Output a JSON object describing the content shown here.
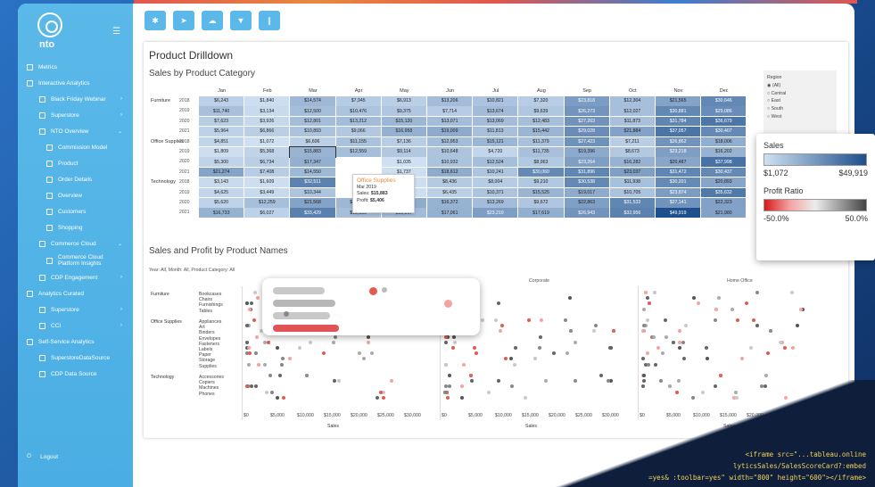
{
  "app": {
    "logo_text": "nto"
  },
  "sidebar": {
    "items": [
      {
        "label": "Metrics",
        "level": 0
      },
      {
        "label": "Interactive Analytics",
        "level": 0
      },
      {
        "label": "Black Friday Webinar",
        "level": 1,
        "arrow": "›"
      },
      {
        "label": "Superstore",
        "level": 1,
        "arrow": "›"
      },
      {
        "label": "NTO Overview",
        "level": 1,
        "arrow": "⌄"
      },
      {
        "label": "Commission Model",
        "level": 2
      },
      {
        "label": "Product",
        "level": 2
      },
      {
        "label": "Order Details",
        "level": 2
      },
      {
        "label": "Overview",
        "level": 2
      },
      {
        "label": "Customers",
        "level": 2
      },
      {
        "label": "Shopping",
        "level": 2
      },
      {
        "label": "Commerce Cloud",
        "level": 1,
        "arrow": "⌄"
      },
      {
        "label": "Commerce Cloud Platform Insights",
        "level": 2
      },
      {
        "label": "CDP Engagement",
        "level": 1,
        "arrow": "›"
      },
      {
        "label": "Analytics Curated",
        "level": 0
      },
      {
        "label": "Superstore",
        "level": 1,
        "arrow": "›"
      },
      {
        "label": "CCI",
        "level": 1,
        "arrow": "›"
      },
      {
        "label": "Self-Service Analytics",
        "level": 0
      },
      {
        "label": "SuperstoreDataSource",
        "level": 1
      },
      {
        "label": "CDP Data Source",
        "level": 1
      }
    ],
    "logout": "Logout"
  },
  "dashboard": {
    "title": "Product Drilldown",
    "section1": "Sales by Product Category",
    "section2": "Sales and Profit by Product Names",
    "filter_text": "Year: All, Month: All, Product Category: All"
  },
  "heatmap": {
    "months": [
      "Jan",
      "Feb",
      "Mar",
      "Apr",
      "May",
      "Jun",
      "Jul",
      "Aug",
      "Sep",
      "Oct",
      "Nov",
      "Dec"
    ],
    "categories": [
      {
        "name": "Furniture",
        "rows": [
          {
            "year": "2018",
            "cells": [
              "$6,243",
              "$1,840",
              "$14,574",
              "$7,945",
              "$6,913",
              "$13,206",
              "$10,821",
              "$7,320",
              "$23,818",
              "$12,304",
              "$21,565",
              "$30,646"
            ]
          },
          {
            "year": "2019",
            "cells": [
              "$11,740",
              "$3,134",
              "$12,500",
              "$10,476",
              "$9,375",
              "$7,714",
              "$13,674",
              "$9,639",
              "$26,273",
              "$12,027",
              "$30,881",
              "$29,086"
            ]
          },
          {
            "year": "2020",
            "cells": [
              "$7,623",
              "$3,926",
              "$12,801",
              "$13,212",
              "$15,120",
              "$13,071",
              "$13,069",
              "$12,483",
              "$27,263",
              "$11,873",
              "$31,784",
              "$36,679"
            ]
          },
          {
            "year": "2021",
            "cells": [
              "$5,964",
              "$6,866",
              "$10,893",
              "$9,066",
              "$16,958",
              "$19,009",
              "$11,813",
              "$15,442",
              "$29,028",
              "$21,884",
              "$37,057",
              "$30,407"
            ]
          }
        ]
      },
      {
        "name": "Office Supplies",
        "rows": [
          {
            "year": "2018",
            "cells": [
              "$4,851",
              "$1,072",
              "$6,606",
              "$11,155",
              "$7,136",
              "$12,953",
              "$15,121",
              "$11,379",
              "$27,423",
              "$7,211",
              "$26,862",
              "$18,006"
            ]
          },
          {
            "year": "2019",
            "cells": [
              "$1,809",
              "$5,368",
              "$15,883",
              "$12,559",
              "$9,114",
              "$10,648",
              "$4,720",
              "$11,735",
              "$19,396",
              "$8,673",
              "$23,218",
              "$16,202"
            ]
          },
          {
            "year": "2020",
            "cells": [
              "$5,300",
              "$6,734",
              "$17,347",
              "",
              "$1,035",
              "$10,932",
              "$12,524",
              "$8,963",
              "$23,264",
              "$16,282",
              "$20,487",
              "$37,998"
            ]
          },
          {
            "year": "2021",
            "cells": [
              "$21,274",
              "$7,408",
              "$14,550",
              "",
              "$1,737",
              "$18,612",
              "$10,241",
              "$30,060",
              "$31,896",
              "$23,037",
              "$31,472",
              "$30,437"
            ]
          }
        ]
      },
      {
        "name": "Technology",
        "rows": [
          {
            "year": "2018",
            "cells": [
              "$3,143",
              "$1,609",
              "$32,511",
              "",
              "$1,600",
              "$8,436",
              "$8,004",
              "$9,210",
              "$30,538",
              "$11,938",
              "$30,201",
              "$20,893"
            ]
          },
          {
            "year": "2019",
            "cells": [
              "$4,625",
              "$3,449",
              "$10,344",
              "",
              "$1,643",
              "$6,435",
              "$10,371",
              "$15,525",
              "$19,017",
              "$10,705",
              "$23,874",
              "$35,632"
            ]
          },
          {
            "year": "2020",
            "cells": [
              "$5,620",
              "$12,259",
              "$21,568",
              "$14,891",
              "$18,633",
              "$16,372",
              "$13,269",
              "$9,672",
              "$22,863",
              "$31,533",
              "$27,141",
              "$22,323"
            ]
          },
          {
            "year": "2021",
            "cells": [
              "$16,733",
              "$6,027",
              "$33,429",
              "$12,383",
              "$13,567",
              "$17,061",
              "$23,210",
              "$17,619",
              "$26,943",
              "$32,956",
              "$49,919",
              "$21,980"
            ]
          }
        ]
      }
    ]
  },
  "tooltip": {
    "title": "Office Supplies",
    "date": "Mar 2019",
    "sales_label": "Sales:",
    "sales_value": "$15,883",
    "profit_label": "Profit:",
    "profit_value": "$5,406"
  },
  "region_filter": {
    "title": "Region",
    "options": [
      "(All)",
      "Central",
      "East",
      "South",
      "West"
    ],
    "selected": "(All)"
  },
  "legend": {
    "sales_title": "Sales",
    "sales_min": "$1,072",
    "sales_max": "$49,919",
    "profit_title": "Profit Ratio",
    "profit_min": "-50.0%",
    "profit_max": "50.0%"
  },
  "scatter": {
    "segments": [
      "",
      "Corporate",
      "Home Office"
    ],
    "categories": [
      {
        "name": "Furniture",
        "subs": [
          "Bookcases",
          "Chairs",
          "Furnishings",
          "Tables"
        ]
      },
      {
        "name": "Office Supplies",
        "subs": [
          "Appliances",
          "Art",
          "Binders",
          "Envelopes",
          "Fasteners",
          "Labels",
          "Paper",
          "Storage",
          "Supplies"
        ]
      },
      {
        "name": "Technology",
        "subs": [
          "Accessories",
          "Copiers",
          "Machines",
          "Phones"
        ]
      }
    ],
    "x_ticks": [
      "$0",
      "$5,000",
      "$10,000",
      "$15,000",
      "$20,000",
      "$25,000",
      "$30,000"
    ],
    "x_label": "Sales"
  },
  "code_overlay": [
    "<iframe src=\"...tableau.online",
    "lyticsSales/SalesScoreCard?:embed",
    "=yes& :toolbar=yes\" width=\"800\" height=\"600\"></iframe>"
  ],
  "colors": {
    "sidebar": "#4aaee4",
    "accent": "#5cb8e8",
    "heat_dark": "#1d4f8c"
  }
}
